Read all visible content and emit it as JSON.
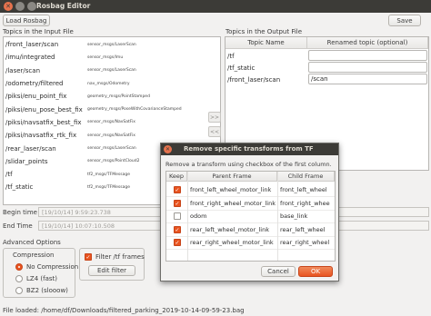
{
  "window": {
    "title": "Rosbag Editor"
  },
  "toolbar": {
    "load_label": "Load Rosbag",
    "save_label": "Save"
  },
  "input_panel": {
    "label": "Topics in the Input File",
    "topics": [
      {
        "name": "/front_laser/scan",
        "type": "sensor_msgs/LaserScan"
      },
      {
        "name": "/imu/integrated",
        "type": "sensor_msgs/Imu"
      },
      {
        "name": "/laser/scan",
        "type": "sensor_msgs/LaserScan"
      },
      {
        "name": "/odometry/filtered",
        "type": "nav_msgs/Odometry"
      },
      {
        "name": "/piksi/enu_point_fix",
        "type": "geometry_msgs/PointStamped"
      },
      {
        "name": "/piksi/enu_pose_best_fix",
        "type": "geometry_msgs/PoseWithCovarianceStamped"
      },
      {
        "name": "/piksi/navsatfix_best_fix",
        "type": "sensor_msgs/NavSatFix"
      },
      {
        "name": "/piksi/navsatfix_rtk_fix",
        "type": "sensor_msgs/NavSatFix"
      },
      {
        "name": "/rear_laser/scan",
        "type": "sensor_msgs/LaserScan"
      },
      {
        "name": "/slidar_points",
        "type": "sensor_msgs/PointCloud2"
      },
      {
        "name": "/tf",
        "type": "tf2_msgs/TFMessage"
      },
      {
        "name": "/tf_static",
        "type": "tf2_msgs/TFMessage"
      }
    ]
  },
  "arrows": {
    "add": ">>",
    "remove": "<<"
  },
  "output_panel": {
    "label": "Topics in the Output File",
    "columns": [
      "Topic Name",
      "Renamed topic (optional)"
    ],
    "rows": [
      {
        "name": "/tf",
        "renamed": ""
      },
      {
        "name": "/tf_static",
        "renamed": ""
      },
      {
        "name": "/front_laser/scan",
        "renamed": "/scan"
      }
    ]
  },
  "time": {
    "begin_label": "Begin time",
    "begin_value": "[19/10/14] 9:59:23.738",
    "end_label": "End Time",
    "end_value": "[19/10/14] 10:07:10.508"
  },
  "advanced": {
    "label": "Advanced Options",
    "compression": {
      "label": "Compression",
      "options": [
        "No Compression",
        "LZ4 (fast)",
        "BZ2 (slooow)"
      ],
      "selected_index": 0
    },
    "filter_tf_label": "Filter /tf frames",
    "filter_tf_checked": true,
    "edit_filter_label": "Edit filter"
  },
  "status": {
    "text": "File loaded: /home/df/Downloads/filtered_parking_2019-10-14-09-59-23.bag"
  },
  "dialog": {
    "title": "Remove specific transforms from TF",
    "instruction": "Remove a transform using checkbox of the first column.",
    "columns": [
      "Keep",
      "Parent Frame",
      "Child Frame"
    ],
    "rows": [
      {
        "keep": true,
        "parent": "front_left_wheel_motor_link",
        "child": "front_left_wheel"
      },
      {
        "keep": true,
        "parent": "front_right_wheel_motor_link",
        "child": "front_right_whee"
      },
      {
        "keep": false,
        "parent": "odom",
        "child": "base_link"
      },
      {
        "keep": true,
        "parent": "rear_left_wheel_motor_link",
        "child": "rear_left_wheel"
      },
      {
        "keep": true,
        "parent": "rear_right_wheel_motor_link",
        "child": "rear_right_wheel"
      }
    ],
    "cancel_label": "Cancel",
    "ok_label": "OK"
  },
  "colors": {
    "accent": "#e95420",
    "titlebar": "#3c3b37"
  }
}
